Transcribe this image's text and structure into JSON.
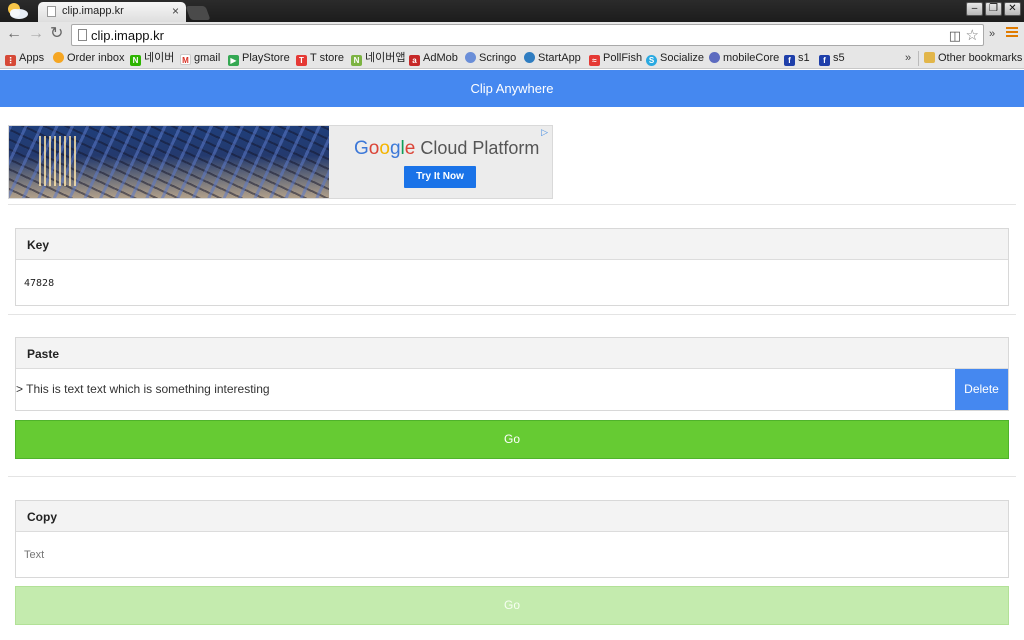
{
  "browser": {
    "tab_title": "clip.imapp.kr",
    "tab_close": "×",
    "url": "clip.imapp.kr",
    "window_buttons": {
      "minimize": "–",
      "restore": "❐",
      "close": "✕"
    },
    "more_extensions": "»",
    "bookmarks": [
      {
        "label": "Apps",
        "icon": "apps-grid-icon",
        "color": "#d64937"
      },
      {
        "label": "Order inbox",
        "icon": "order-inbox-icon",
        "color": "#f5a623"
      },
      {
        "label": "네이버",
        "icon": "naver-icon",
        "color": "#2db400"
      },
      {
        "label": "gmail",
        "icon": "gmail-icon",
        "color": "#d93025"
      },
      {
        "label": "PlayStore",
        "icon": "playstore-icon",
        "color": "#34a853"
      },
      {
        "label": "T store",
        "icon": "tstore-icon",
        "color": "#e53935"
      },
      {
        "label": "네이버앱",
        "icon": "naver-app-icon",
        "color": "#7cb342"
      },
      {
        "label": "AdMob",
        "icon": "admob-icon",
        "color": "#c62828"
      },
      {
        "label": "Scringo",
        "icon": "scringo-icon",
        "color": "#6a8ed8"
      },
      {
        "label": "StartApp",
        "icon": "startapp-icon",
        "color": "#2f7dc1"
      },
      {
        "label": "PollFish",
        "icon": "pollfish-icon",
        "color": "#e53935"
      },
      {
        "label": "Socialize",
        "icon": "socialize-icon",
        "color": "#29a9e1"
      },
      {
        "label": "mobileCore",
        "icon": "mobilecore-icon",
        "color": "#5c6bc0"
      },
      {
        "label": "s1",
        "icon": "s1-icon",
        "color": "#1e3faa"
      },
      {
        "label": "s5",
        "icon": "s5-icon",
        "color": "#1e3faa"
      }
    ],
    "bookmarks_more": "»",
    "other_bookmarks": "Other bookmarks"
  },
  "app": {
    "title": "Clip Anywhere",
    "accent_color": "#4588f0",
    "go_color": "#66cb33"
  },
  "ad": {
    "brand_g": "G",
    "brand_o1": "o",
    "brand_o2": "o",
    "brand_g2": "g",
    "brand_l": "l",
    "brand_e": "e",
    "brand_rest": " Cloud Platform",
    "cta": "Try It Now",
    "choice": "▷"
  },
  "key_panel": {
    "heading": "Key",
    "value": "47828"
  },
  "paste_panel": {
    "heading": "Paste",
    "text": "> This is text text which is something interesting",
    "delete_label": "Delete",
    "go_label": "Go"
  },
  "copy_panel": {
    "heading": "Copy",
    "placeholder": "Text",
    "go_label": "Go"
  }
}
